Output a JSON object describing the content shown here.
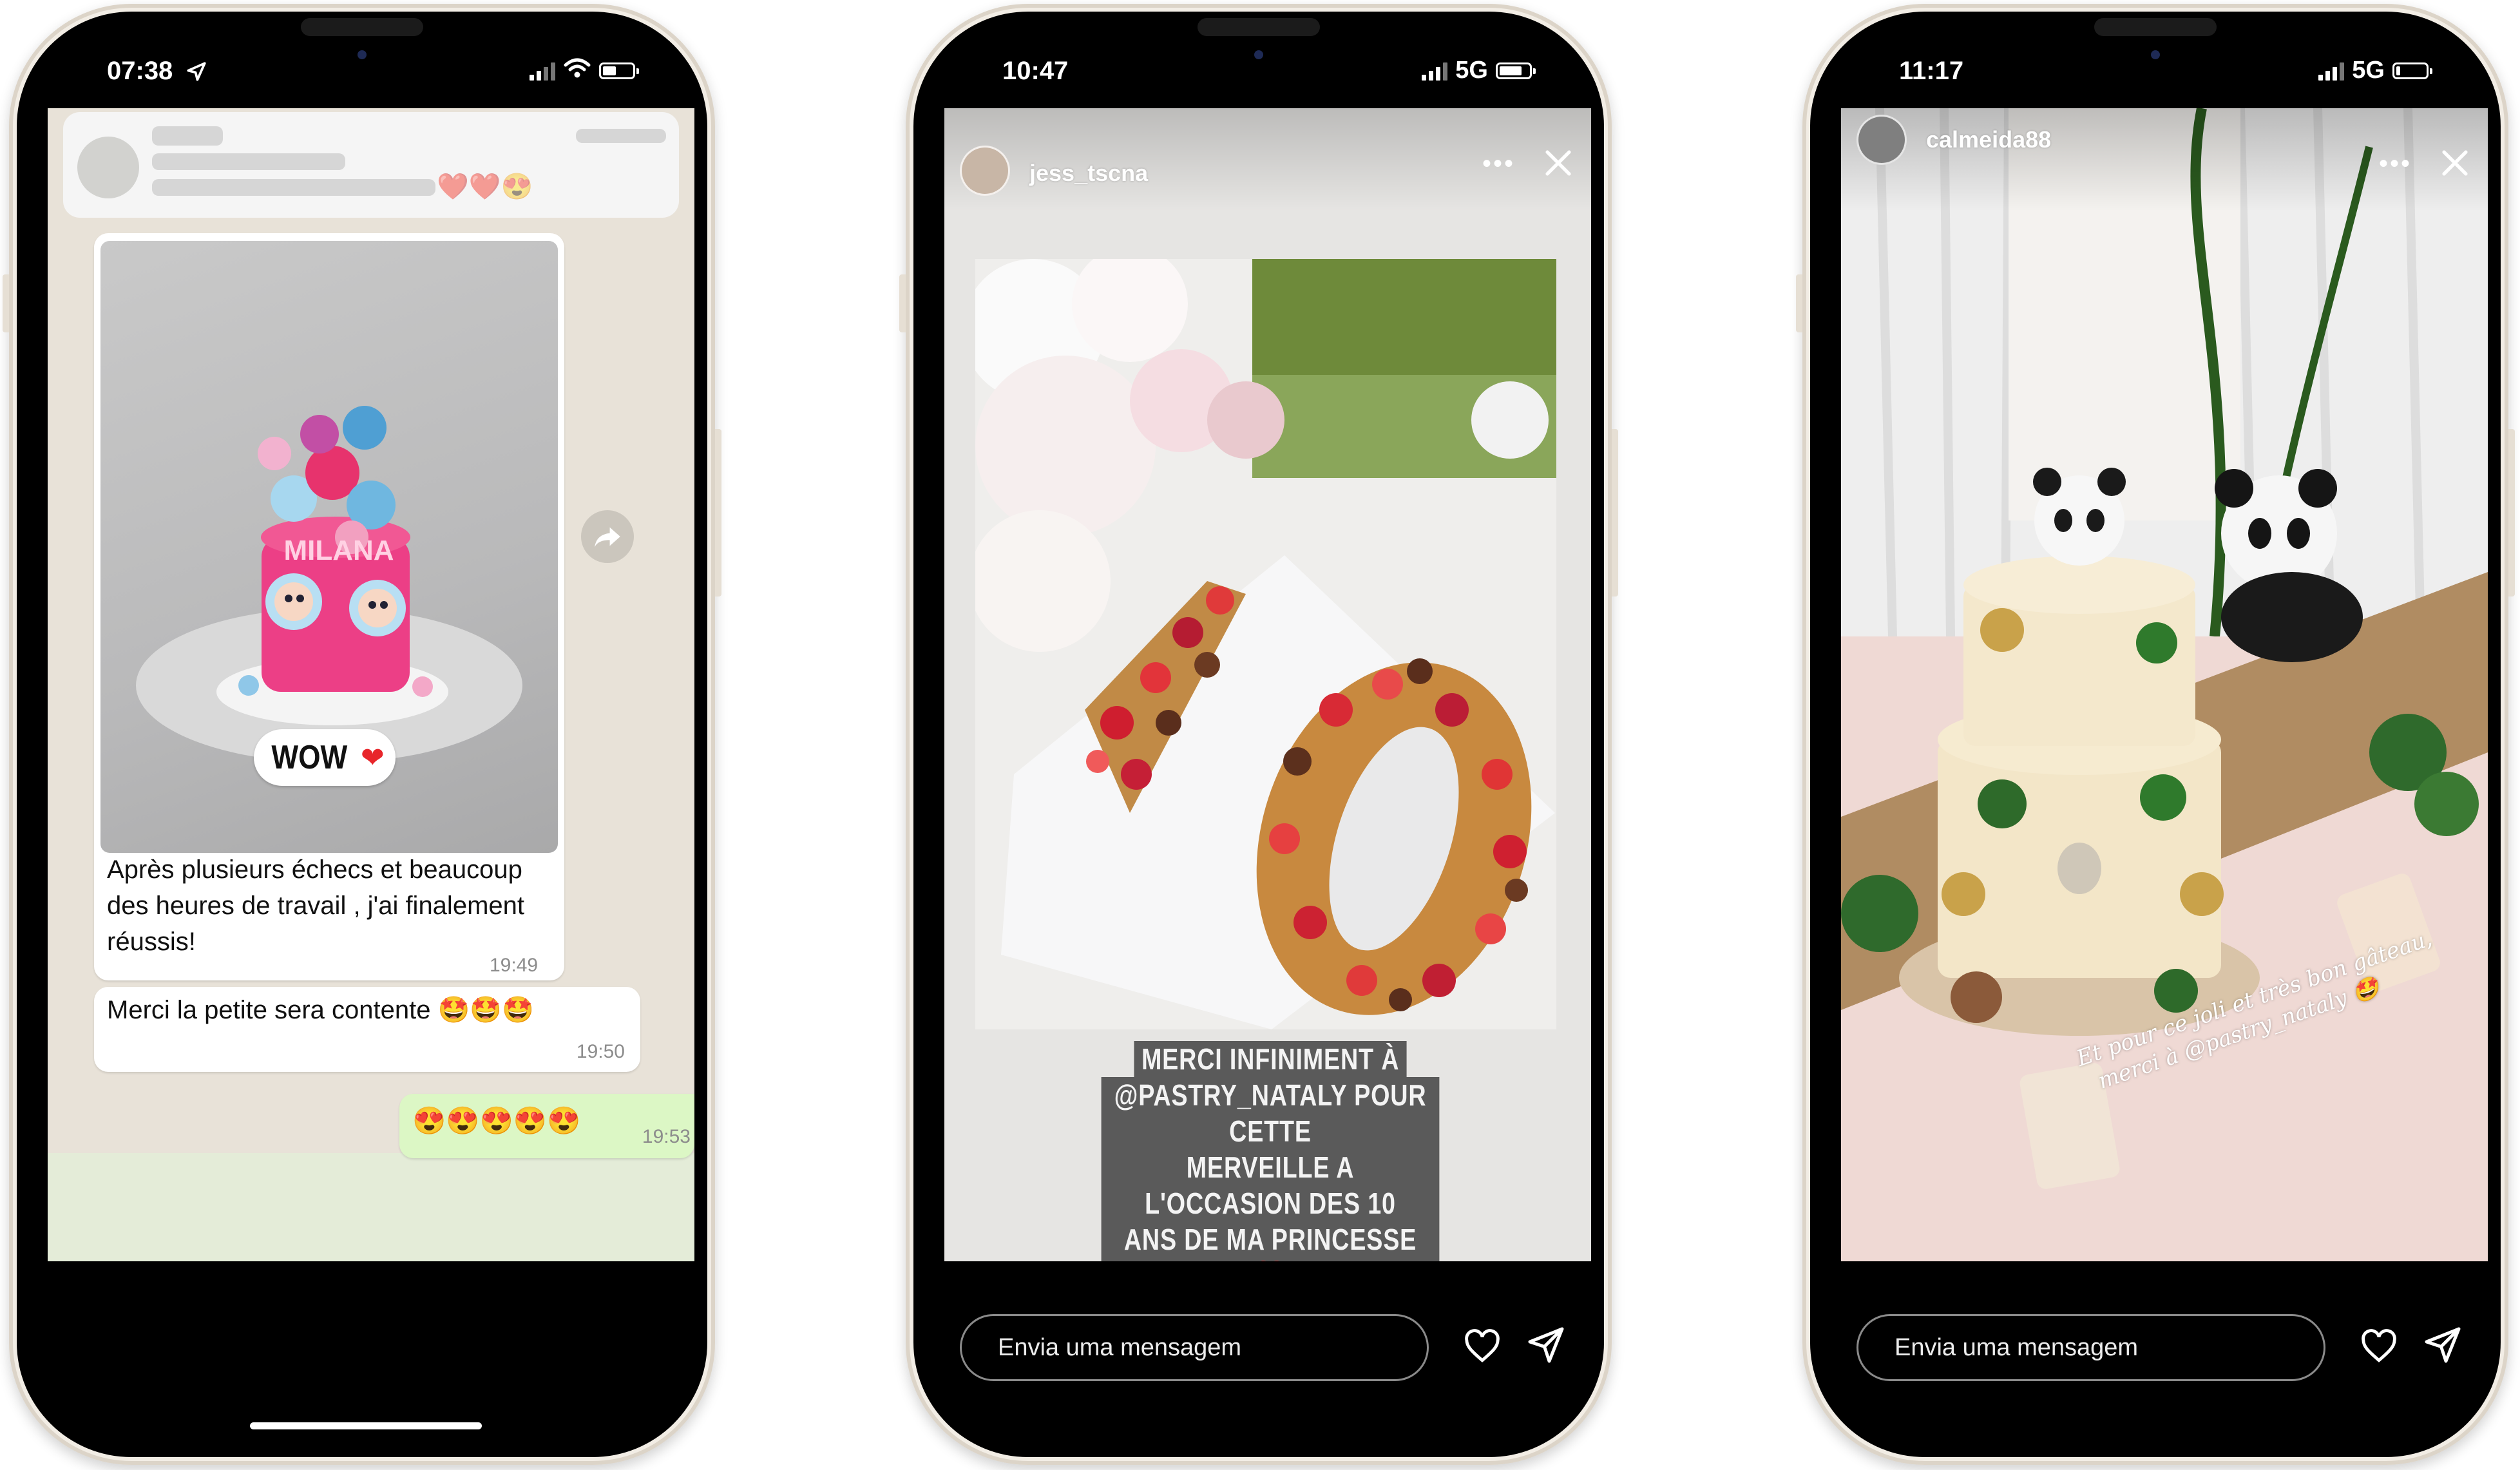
{
  "phones": [
    {
      "status_time": "07:38",
      "app": "whatsapp",
      "notification": {
        "sender": "",
        "preview_line1": "",
        "preview_line2": ""
      },
      "cake_topper_text": "MILANA",
      "sticker_text": "WOW",
      "messages": [
        {
          "text": "Après plusieurs échecs et beaucoup des heures de travail , j'ai finalement réussis!",
          "time": "19:49",
          "direction": "incoming",
          "has_image": true
        },
        {
          "text": "Merci la petite sera contente 🤩🤩🤩",
          "time": "19:50",
          "direction": "incoming"
        },
        {
          "text": "😍😍😍😍😍",
          "time": "19:53",
          "direction": "outgoing"
        }
      ]
    },
    {
      "status_time": "10:47",
      "network": "5G",
      "app": "instagram-story",
      "username": "jess_tscna",
      "caption_lines": [
        "MERCI INFINIMENT À",
        "@PASTRY_NATALY POUR CETTE",
        "MERVEILLE A L'OCCASION DES 10",
        "ANS DE MA PRINCESSE ❤️"
      ],
      "message_placeholder": "Envia uma mensagem"
    },
    {
      "status_time": "11:17",
      "network": "5G",
      "app": "instagram-story",
      "username": "calmeida88",
      "handwritten_caption": [
        "Et pour ce joli et très bon gâteau,",
        "merci à @pastry_nataly 🤩"
      ],
      "message_placeholder": "Envia uma mensagem"
    }
  ],
  "icons": {
    "location": "location-arrow-icon",
    "wifi": "wifi-icon",
    "forward": "forward-icon",
    "more": "more-dots-icon",
    "close": "close-icon",
    "heart": "heart-icon",
    "send": "send-icon"
  },
  "colors": {
    "wa_incoming": "#ffffff",
    "wa_outgoing": "#dcf7c5",
    "phone_frame": "#f2ede5",
    "caption_bg": "#5a5a5a"
  }
}
